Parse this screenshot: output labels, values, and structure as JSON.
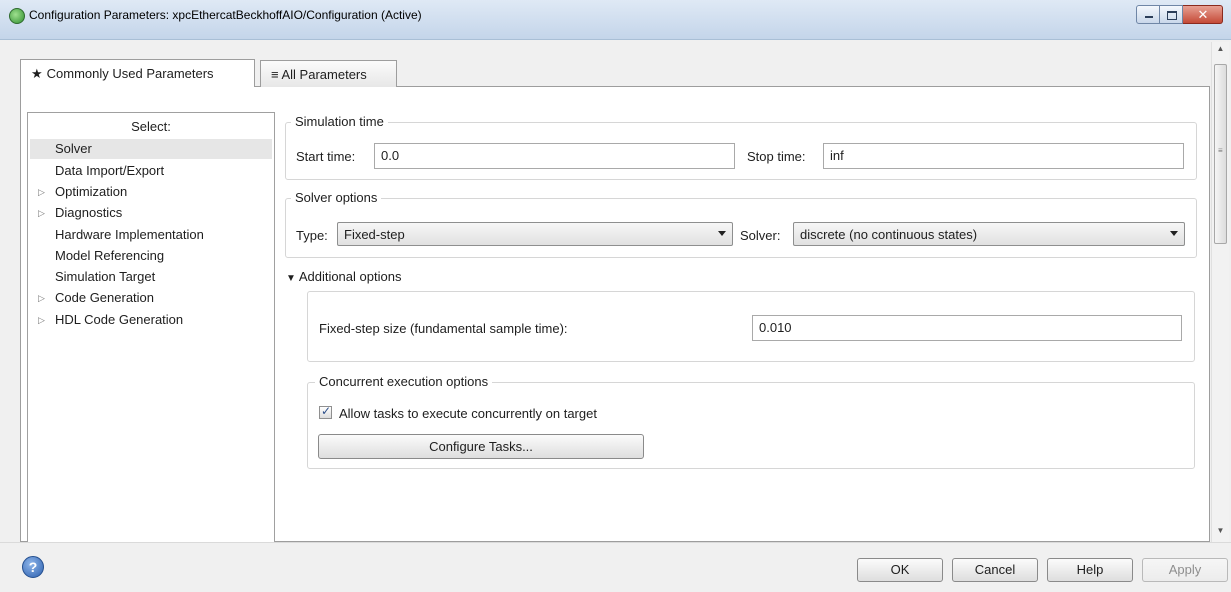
{
  "window": {
    "title": "Configuration Parameters: xpcEthercatBeckhoffAIO/Configuration (Active)",
    "close_glyph": "✕"
  },
  "tabs": [
    {
      "label": "Commonly Used Parameters",
      "icon": "★",
      "active": true
    },
    {
      "label": "All Parameters",
      "icon": "≡",
      "active": false
    }
  ],
  "sidebar": {
    "header": "Select:",
    "items": [
      {
        "label": "Solver",
        "expandable": false,
        "selected": true
      },
      {
        "label": "Data Import/Export",
        "expandable": false,
        "selected": false
      },
      {
        "label": "Optimization",
        "expandable": true,
        "selected": false
      },
      {
        "label": "Diagnostics",
        "expandable": true,
        "selected": false
      },
      {
        "label": "Hardware Implementation",
        "expandable": false,
        "selected": false
      },
      {
        "label": "Model Referencing",
        "expandable": false,
        "selected": false
      },
      {
        "label": "Simulation Target",
        "expandable": false,
        "selected": false
      },
      {
        "label": "Code Generation",
        "expandable": true,
        "selected": false
      },
      {
        "label": "HDL Code Generation",
        "expandable": true,
        "selected": false
      }
    ],
    "expand_glyph": "▷"
  },
  "simulation_time": {
    "title": "Simulation time",
    "start_label": "Start time:",
    "start_value": "0.0",
    "stop_label": "Stop time:",
    "stop_value": "inf"
  },
  "solver_options": {
    "title": "Solver options",
    "type_label": "Type:",
    "type_value": "Fixed-step",
    "solver_label": "Solver:",
    "solver_value": "discrete (no continuous states)"
  },
  "additional_options": {
    "toggle_glyph": "▼",
    "title": "Additional options",
    "fixed_step_label": "Fixed-step size (fundamental sample time):",
    "fixed_step_value": "0.010"
  },
  "concurrent": {
    "title": "Concurrent execution options",
    "allow_label": "Allow tasks to execute concurrently on target",
    "allow_checked": true,
    "check_glyph": "✓",
    "configure_button": "Configure Tasks..."
  },
  "buttons": {
    "help_glyph": "?",
    "ok": "OK",
    "cancel": "Cancel",
    "help": "Help",
    "apply": "Apply"
  },
  "scrollbar": {
    "up_glyph": "▲",
    "down_glyph": "▼",
    "grip_glyph": "≡"
  }
}
